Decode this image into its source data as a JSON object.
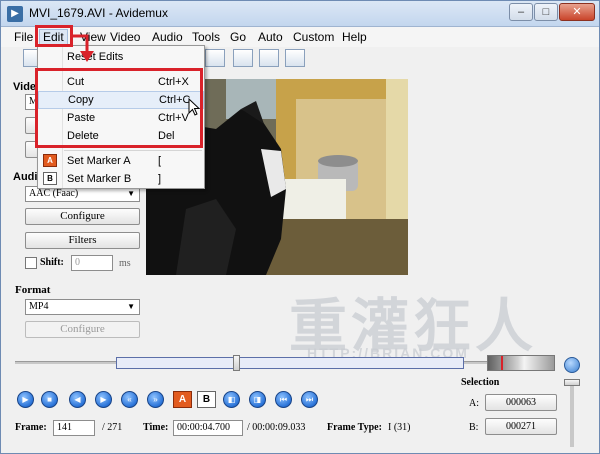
{
  "window": {
    "title": "MVI_1679.AVI - Avidemux",
    "buttons": {
      "minimize": "–",
      "maximize": "□",
      "close": "✕"
    }
  },
  "menubar": {
    "items": [
      "File",
      "Edit",
      "View",
      "Video",
      "Audio",
      "Tools",
      "Go",
      "Auto",
      "Custom",
      "Help"
    ],
    "active": "Edit"
  },
  "edit_menu": {
    "items": [
      {
        "label": "Reset Edits",
        "shortcut": ""
      },
      {
        "label": "Cut",
        "shortcut": "Ctrl+X"
      },
      {
        "label": "Copy",
        "shortcut": "Ctrl+C"
      },
      {
        "label": "Paste",
        "shortcut": "Ctrl+V"
      },
      {
        "label": "Delete",
        "shortcut": "Del"
      },
      {
        "label": "Set Marker A",
        "shortcut": "[",
        "icon": "A"
      },
      {
        "label": "Set Marker B",
        "shortcut": "]",
        "icon": "B"
      }
    ],
    "hovered": "Copy"
  },
  "left_panel": {
    "video_label": "Vide",
    "video_codec_partial": "M",
    "audio_label": "Audi",
    "audio_codec": "AAC (Faac)",
    "audio_configure": "Configure",
    "audio_filters": "Filters",
    "shift_label": "Shift:",
    "shift_value": "0",
    "shift_unit": "ms",
    "format_label": "Format",
    "format_value": "MP4",
    "format_configure": "Configure"
  },
  "navigation": {
    "buttons": [
      "play",
      "stop",
      "prev-frame",
      "next-frame",
      "prev-keyframe",
      "next-keyframe"
    ],
    "marker_a": "A",
    "marker_b": "B"
  },
  "status": {
    "frame_label": "Frame:",
    "frame_value": "141",
    "frame_total": "/ 271",
    "time_label": "Time:",
    "time_value": "00:00:04.700",
    "time_total": "/ 00:00:09.033",
    "frame_type_label": "Frame Type:",
    "frame_type_value": "I (31)"
  },
  "selection": {
    "title": "Selection",
    "a_label": "A:",
    "a_value": "000063",
    "b_label": "B:",
    "b_value": "000271"
  },
  "colors": {
    "highlight": "#d9222a",
    "accent_blue": "#2a73d8"
  }
}
